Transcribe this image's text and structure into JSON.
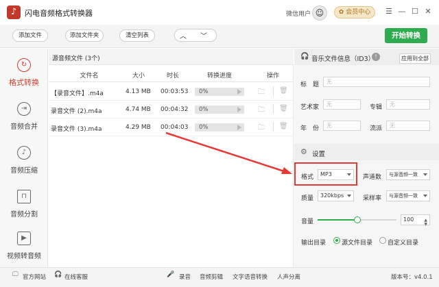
{
  "app": {
    "title": "闪电音频格式转换器",
    "logo_glyph": "♪"
  },
  "titlebar": {
    "user_label": "微信用户",
    "avatar_glyph": "☺",
    "vip_label": "✿ 会员中心",
    "controls": [
      "☰",
      "—",
      "☐",
      "✕"
    ]
  },
  "toolbar": {
    "add_file": "添加文件",
    "add_folder": "添加文件夹",
    "clear_list": "清空列表",
    "up_arrow": "︿",
    "down_arrow": "﹀",
    "start": "开始转换"
  },
  "sidebar": {
    "items": [
      {
        "label": "格式转换",
        "icon": "↻",
        "active": true
      },
      {
        "label": "音频合并",
        "icon": "⇥"
      },
      {
        "label": "音频压缩",
        "icon": "♪"
      },
      {
        "label": "音频分割",
        "icon": "⊓"
      },
      {
        "label": "视频转音频",
        "icon": "▶"
      }
    ]
  },
  "file_list": {
    "header": "源音频文件 (3个)",
    "columns": [
      "文件名",
      "大小",
      "时长",
      "转换进度",
      "操作"
    ],
    "rows": [
      {
        "name": "【录音文件】.m4a",
        "size": "4.13 MB",
        "duration": "00:03:53",
        "progress": "0%"
      },
      {
        "name": "录音文件 (2).m4a",
        "size": "4.74 MB",
        "duration": "00:04:32",
        "progress": "0%"
      },
      {
        "name": "录音文件 (3).m4a",
        "size": "4.29 MB",
        "duration": "00:04:03",
        "progress": "0%"
      }
    ]
  },
  "id3": {
    "title": "音乐文件信息（ID3）",
    "apply_all": "应用到全部",
    "fields": {
      "title_label": "标　题",
      "artist_label": "艺术家",
      "album_label": "专辑",
      "year_label": "年　份",
      "genre_label": "流派",
      "placeholder": "无"
    }
  },
  "settings": {
    "title": "设置",
    "format_label": "格式",
    "format_value": "MP3",
    "channels_label": "声道数",
    "channels_value": "与源音频一致",
    "quality_label": "质量",
    "quality_value": "320kbps",
    "samplerate_label": "采样率",
    "samplerate_value": "与源音频一致",
    "volume_label": "音量",
    "volume_value": "100",
    "volume_level": 0.5,
    "output_label": "输出目录",
    "output_source": "源文件目录",
    "output_custom": "自定义目录",
    "output_selected": "源文件目录"
  },
  "statusbar": {
    "website": "官方网站",
    "support": "在线客服",
    "tools": [
      "录音",
      "音频剪辑",
      "文字语音转换",
      "人声分离"
    ],
    "version": "版本号：v4.0.1"
  },
  "colors": {
    "accent_red": "#d23a2e",
    "start_green": "#2eab4f",
    "annotation_red": "#e53935"
  }
}
